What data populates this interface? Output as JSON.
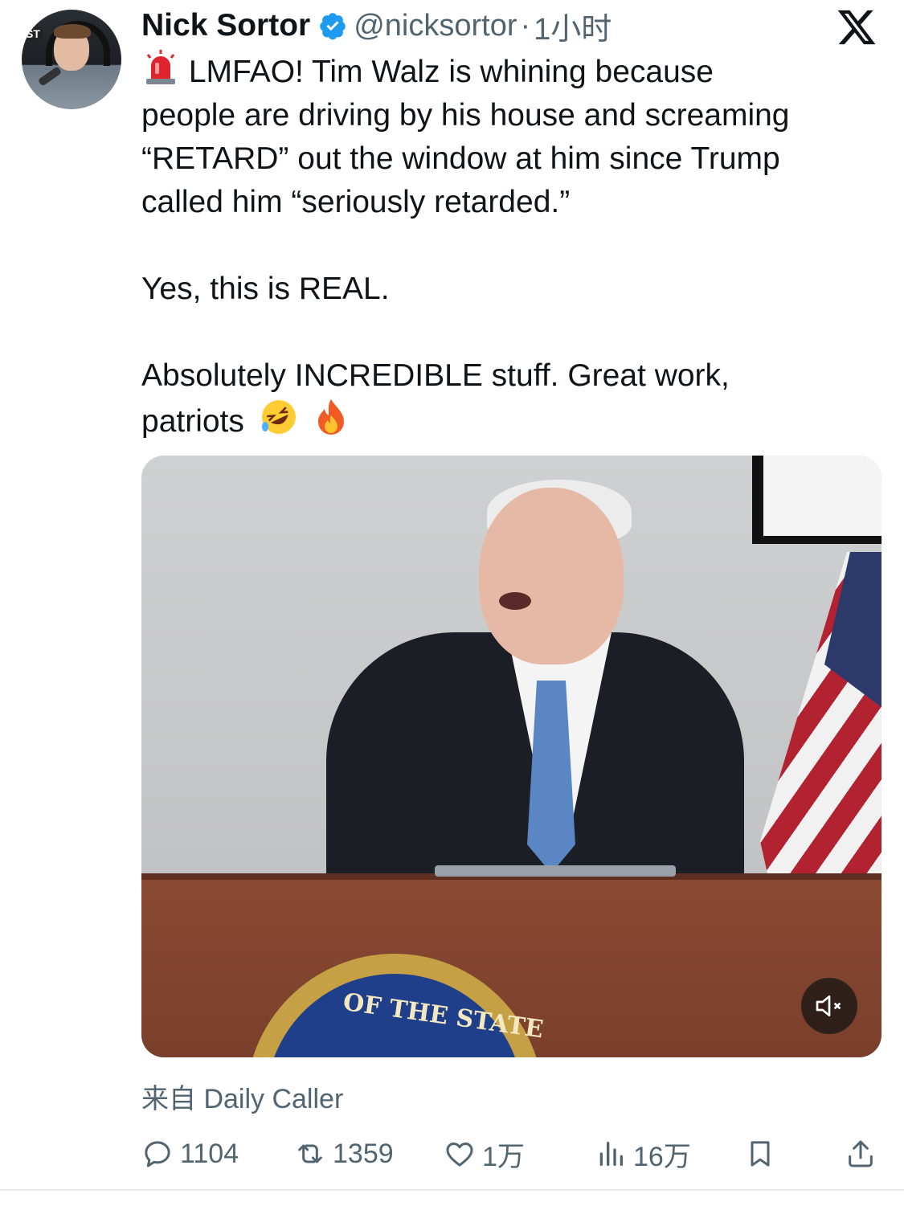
{
  "tweet": {
    "author_name": "Nick Sortor",
    "author_handle": "@nicksortor",
    "separator": "·",
    "time": "1小时",
    "line1": "LMFAO! Tim Walz is whining because",
    "line2": "people are driving by his house and screaming",
    "line3": "“RETARD” out the window at him since Trump",
    "line4": "called him “seriously retarded.”",
    "para2": "Yes, this is REAL.",
    "para3_line1": "Absolutely INCREDIBLE stuff. Great work,",
    "para3_line2": "patriots",
    "emojis": [
      "police-light-icon",
      "rolling-laughing-icon",
      "fire-icon"
    ]
  },
  "media": {
    "seal_text": "OF THE STATE",
    "mute_icon": "speaker-muted-icon"
  },
  "source": "来自 Daily Caller",
  "actions": {
    "replies": "1104",
    "reposts": "1359",
    "likes": "1万",
    "views": "16万"
  },
  "colors": {
    "text": "#0f1419",
    "secondary": "#536471",
    "verified": "#1d9bf0"
  }
}
